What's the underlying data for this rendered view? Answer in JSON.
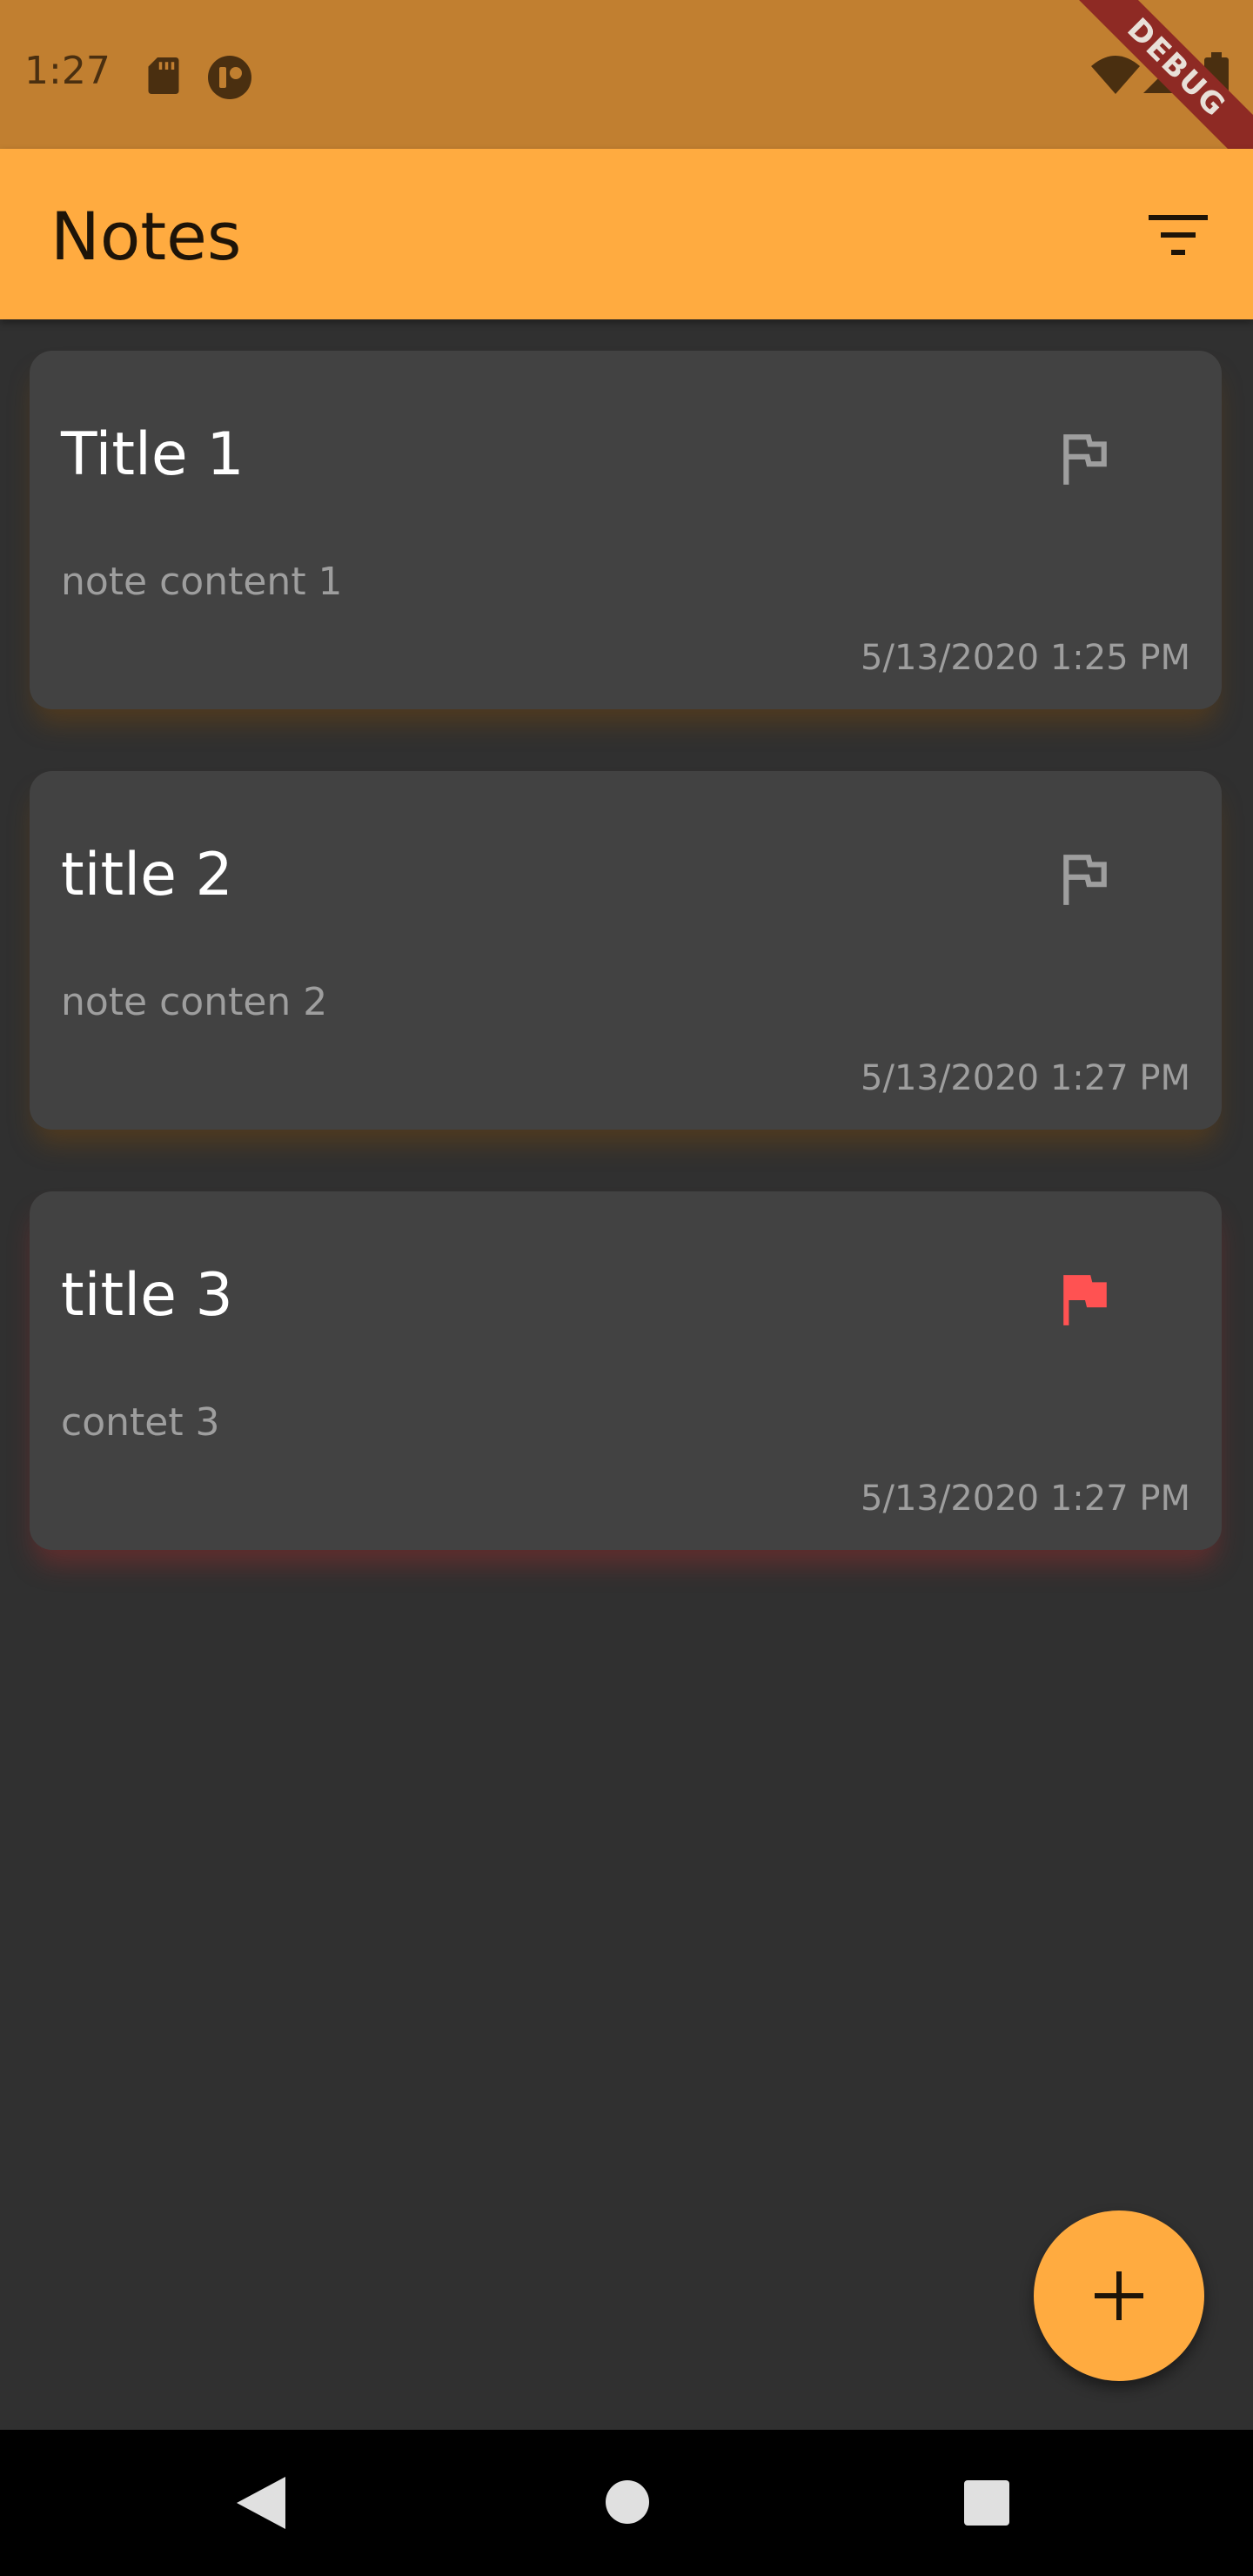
{
  "status_bar": {
    "time": "1:27",
    "icons": [
      "sd-card-icon",
      "cast-icon",
      "wifi-icon",
      "signal-icon",
      "battery-icon"
    ],
    "debug_banner": "DEBUG"
  },
  "app_bar": {
    "title": "Notes",
    "filter_icon": "filter-list-icon"
  },
  "notes": [
    {
      "title": "Title 1",
      "content": "note content 1",
      "date": "5/13/2020 1:25 PM",
      "flagged": false
    },
    {
      "title": "title 2",
      "content": "note conten 2",
      "date": "5/13/2020 1:27 PM",
      "flagged": false
    },
    {
      "title": "title 3",
      "content": "contet 3",
      "date": "5/13/2020 1:27 PM",
      "flagged": true
    }
  ],
  "fab": {
    "icon": "add-icon"
  },
  "nav_bar": {
    "icons": [
      "back-icon",
      "home-icon",
      "recents-icon"
    ]
  },
  "colors": {
    "status_bar": "#c17f30",
    "accent": "#ffab40",
    "background": "#303030",
    "card": "#424242",
    "flag_active": "#ff5252",
    "flag_inactive": "#9e9e9e"
  }
}
